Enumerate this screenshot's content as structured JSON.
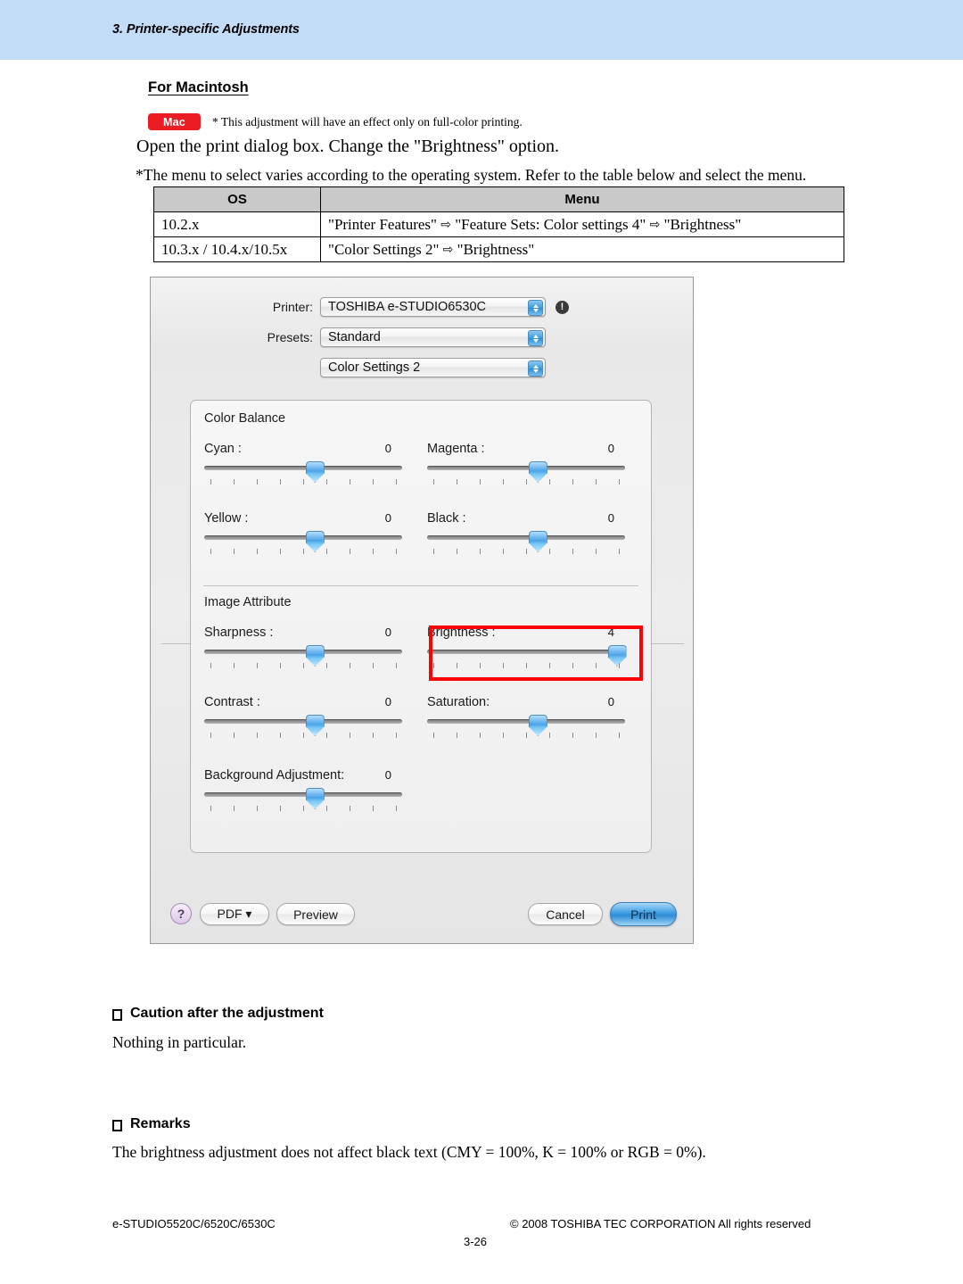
{
  "header": {
    "chapter": "3. Printer-specific Adjustments"
  },
  "section": {
    "title": "For Macintosh",
    "badge": "Mac",
    "badge_note": "* This adjustment will have an effect only on full-color printing.",
    "instruction": "Open the print dialog box.  Change the \"Brightness\" option.",
    "menu_note": "*The menu to select varies according to the operating system.  Refer to the table below and select the menu."
  },
  "os_table": {
    "headers": [
      "OS",
      "Menu"
    ],
    "rows": [
      {
        "os": "10.2.x",
        "menu_parts": [
          "\"Printer Features\"",
          "\"Feature Sets: Color settings 4\"",
          "\"Brightness\""
        ]
      },
      {
        "os": "10.3.x / 10.4.x/10.5x",
        "menu_parts": [
          "\"Color Settings 2\"",
          "\"Brightness\""
        ]
      }
    ],
    "arrow": "⇨"
  },
  "print_dialog": {
    "printer_label": "Printer:",
    "printer_value": "TOSHIBA e-STUDIO6530C",
    "info_icon": "!",
    "presets_label": "Presets:",
    "presets_value": "Standard",
    "pane_value": "Color Settings 2",
    "groups": [
      {
        "title": "Color Balance"
      },
      {
        "title": "Image Attribute"
      }
    ],
    "sliders": [
      {
        "name": "cyan",
        "label": "Cyan :",
        "value": "0",
        "pos": 4
      },
      {
        "name": "magenta",
        "label": "Magenta :",
        "value": "0",
        "pos": 4
      },
      {
        "name": "yellow",
        "label": "Yellow :",
        "value": "0",
        "pos": 4
      },
      {
        "name": "black",
        "label": "Black :",
        "value": "0",
        "pos": 4
      },
      {
        "name": "sharpness",
        "label": "Sharpness :",
        "value": "0",
        "pos": 4
      },
      {
        "name": "brightness",
        "label": "Brightness :",
        "value": "4",
        "pos": 8
      },
      {
        "name": "contrast",
        "label": "Contrast :",
        "value": "0",
        "pos": 4
      },
      {
        "name": "saturation",
        "label": "Saturation:",
        "value": "0",
        "pos": 4
      },
      {
        "name": "background",
        "label": "Background Adjustment:",
        "value": "0",
        "pos": 4
      }
    ],
    "footer": {
      "help": "?",
      "pdf": "PDF ▾",
      "preview": "Preview",
      "cancel": "Cancel",
      "print": "Print"
    },
    "highlight_color": "#ff0000"
  },
  "caution": {
    "heading": "Caution after the adjustment",
    "body": "Nothing in particular."
  },
  "remarks": {
    "heading": "Remarks",
    "body": "The brightness adjustment does not affect black text (CMY = 100%, K = 100% or RGB = 0%)."
  },
  "footer": {
    "left": "e-STUDIO5520C/6520C/6530C",
    "right": "© 2008 TOSHIBA TEC CORPORATION All rights reserved",
    "page": "3-26"
  }
}
